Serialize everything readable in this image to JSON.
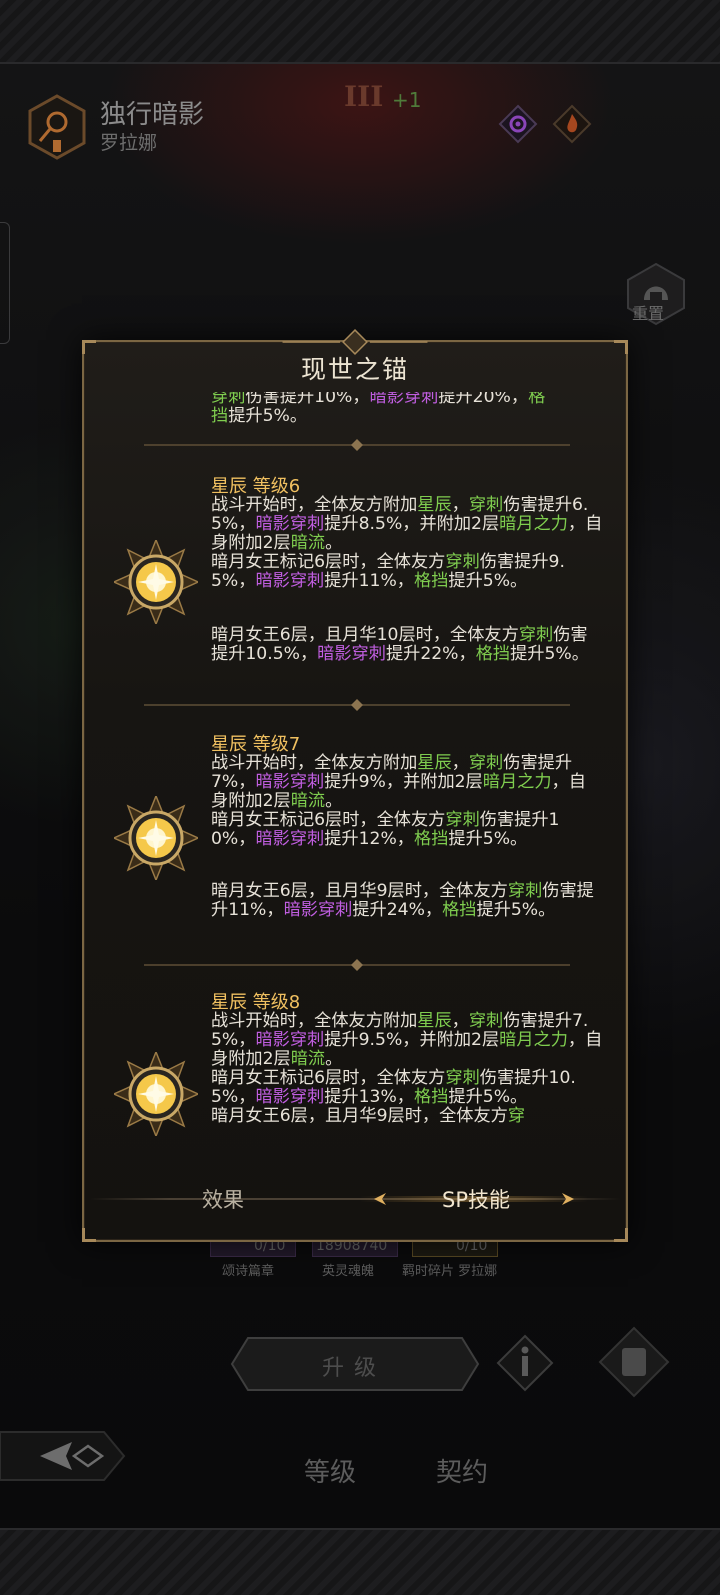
{
  "hero": {
    "name": "独行暗影",
    "subname": "罗拉娜",
    "rank_roman": "III",
    "rank_plus": "+1"
  },
  "reset_label": "重置",
  "resources": {
    "values": [
      "0/10",
      "18908740",
      "0/10"
    ],
    "labels": [
      "颂诗篇章",
      "英灵魂魄",
      "羁时碎片 罗拉娜"
    ]
  },
  "upgrade_label": "升级",
  "nav": {
    "level": "等级",
    "contract": "契约"
  },
  "modal": {
    "title": "现世之锚",
    "tabs": {
      "effect": "效果",
      "sp": "SP技能"
    },
    "entries": [
      {
        "level": "星辰  等级6"
      },
      {
        "level": "星辰  等级7"
      },
      {
        "level": "星辰  等级8"
      }
    ]
  },
  "colors": {
    "keyword_green": "#7fcd4f",
    "keyword_purple": "#c05ee0",
    "level_gold": "#f0c060",
    "frame_gold": "#7b6643"
  },
  "icons": [
    "hero-class-icon",
    "shadow-element-icon",
    "fire-element-icon",
    "reset-helmet-icon",
    "star-skill-icon",
    "info-icon",
    "scroll-icon",
    "back-arrow-icon"
  ]
}
